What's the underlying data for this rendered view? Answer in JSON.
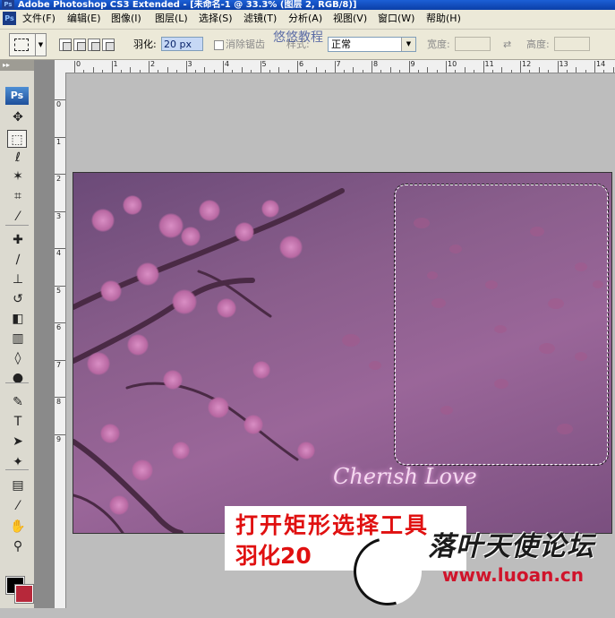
{
  "window": {
    "title": "Adobe Photoshop CS3 Extended - [未命名-1 @ 33.3% (图层 2, RGB/8)]",
    "app_icon": "Ps"
  },
  "menu": {
    "items": [
      "文件(F)",
      "编辑(E)",
      "图像(I)",
      "图层(L)",
      "选择(S)",
      "滤镜(T)",
      "分析(A)",
      "视图(V)",
      "窗口(W)",
      "帮助(H)"
    ]
  },
  "options": {
    "feather_label": "羽化:",
    "feather_value": "20 px",
    "antialias_label": "消除锯齿",
    "style_label": "样式:",
    "style_value": "正常",
    "width_label": "宽度:",
    "height_label": "高度:"
  },
  "watermark_text": "悠悠教程",
  "rulers": {
    "horizontal_ticks": [
      "0",
      "1",
      "2",
      "3",
      "4",
      "5",
      "6",
      "7",
      "8",
      "9",
      "10",
      "11",
      "12",
      "13",
      "14"
    ],
    "vertical_ticks": [
      "0",
      "1",
      "2",
      "3",
      "4",
      "5",
      "6",
      "7",
      "8",
      "9"
    ]
  },
  "toolbox": {
    "logo": "Ps",
    "tools": [
      {
        "name": "move-icon",
        "glyph": "✥"
      },
      {
        "name": "rect-marquee-icon",
        "glyph": "⬚"
      },
      {
        "name": "lasso-icon",
        "glyph": "ℓ"
      },
      {
        "name": "magic-wand-icon",
        "glyph": "✶"
      },
      {
        "name": "crop-icon",
        "glyph": "⌗"
      },
      {
        "name": "eyedropper-icon",
        "glyph": "⁄"
      },
      {
        "name": "spot-heal-icon",
        "glyph": "✚"
      },
      {
        "name": "brush-icon",
        "glyph": "∕"
      },
      {
        "name": "stamp-icon",
        "glyph": "⊥"
      },
      {
        "name": "history-brush-icon",
        "glyph": "↺"
      },
      {
        "name": "eraser-icon",
        "glyph": "◧"
      },
      {
        "name": "gradient-icon",
        "glyph": "▥"
      },
      {
        "name": "blur-icon",
        "glyph": "◊"
      },
      {
        "name": "dodge-icon",
        "glyph": "●"
      },
      {
        "name": "pen-icon",
        "glyph": "✎"
      },
      {
        "name": "type-icon",
        "glyph": "T"
      },
      {
        "name": "path-select-icon",
        "glyph": "➤"
      },
      {
        "name": "shape-icon",
        "glyph": "✦"
      },
      {
        "name": "notes-icon",
        "glyph": "▤"
      },
      {
        "name": "eyedropper2-icon",
        "glyph": "⁄"
      },
      {
        "name": "hand-icon",
        "glyph": "✋"
      },
      {
        "name": "zoom-icon",
        "glyph": "⚲"
      }
    ],
    "foreground_color": "#000000",
    "background_color": "#b7283a"
  },
  "canvas": {
    "signature": "Cherish Love"
  },
  "caption": {
    "line1": "打开矩形选择工具",
    "line2": "羽化20"
  },
  "forum": {
    "name": "落叶天使论坛",
    "url": "www.luoan.cn"
  }
}
